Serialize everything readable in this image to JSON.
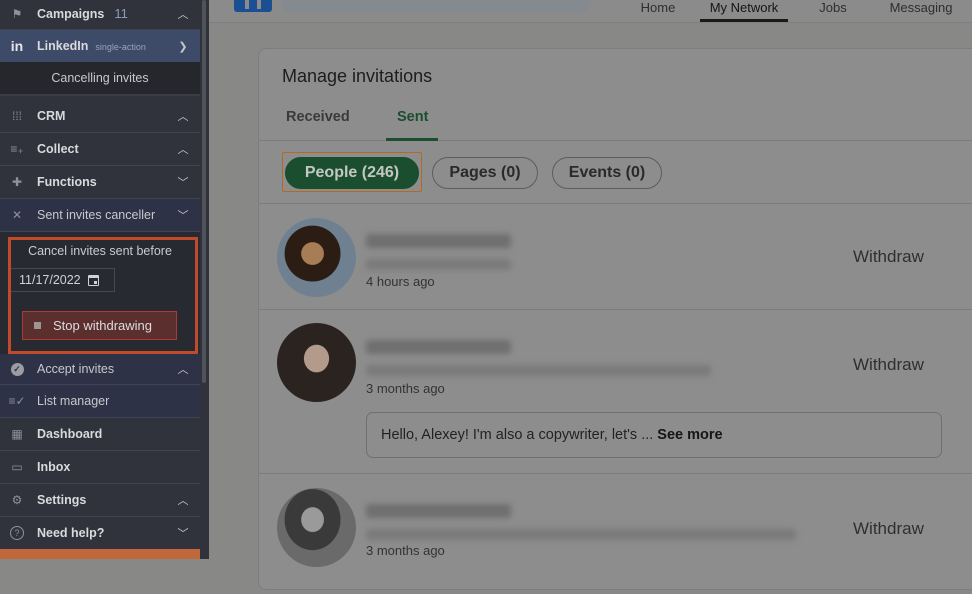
{
  "sidebar": {
    "campaigns": {
      "label": "Campaigns",
      "count": "11",
      "icon": "flag-icon"
    },
    "linkedin": {
      "label": "LinkedIn",
      "tag": "single-action",
      "icon": "linkedin-icon"
    },
    "linkedin_sub": {
      "label": "Cancelling invites"
    },
    "crm": {
      "label": "CRM",
      "icon": "grid-icon"
    },
    "collect": {
      "label": "Collect",
      "icon": "list-add-icon"
    },
    "functions": {
      "label": "Functions",
      "icon": "puzzle-icon"
    },
    "canceller": {
      "label": "Sent invites canceller",
      "icon": "close-icon"
    },
    "panel": {
      "title": "Cancel invites sent before",
      "date": "11/17/2022",
      "stop_label": "Stop withdrawing"
    },
    "accept": {
      "label": "Accept invites",
      "icon": "check-circle-icon"
    },
    "list_manager": {
      "label": "List manager",
      "icon": "list-check-icon"
    },
    "dashboard": {
      "label": "Dashboard",
      "icon": "dashboard-icon"
    },
    "inbox": {
      "label": "Inbox",
      "icon": "inbox-icon"
    },
    "settings": {
      "label": "Settings",
      "icon": "gear-icon"
    },
    "help": {
      "label": "Need help?",
      "icon": "question-icon"
    }
  },
  "topnav": {
    "items": [
      "Home",
      "My Network",
      "Jobs",
      "Messaging"
    ],
    "active": "My Network"
  },
  "manage": {
    "title": "Manage invitations",
    "tabs": [
      "Received",
      "Sent"
    ],
    "active_tab": "Sent",
    "filters": [
      "People (246)",
      "Pages (0)",
      "Events (0)"
    ],
    "active_filter": "People (246)",
    "people": [
      {
        "time": "4 hours ago",
        "action": "Withdraw"
      },
      {
        "time": "3 months ago",
        "action": "Withdraw",
        "message": "Hello, Alexey! I'm also a copywriter, let's ...",
        "see_more": "See more"
      },
      {
        "time": "3 months ago",
        "action": "Withdraw"
      }
    ]
  },
  "colors": {
    "accent_green": "#1b4d2f",
    "highlight_orange": "#c24a2c",
    "linkedin_blue": "#1c4e93"
  }
}
